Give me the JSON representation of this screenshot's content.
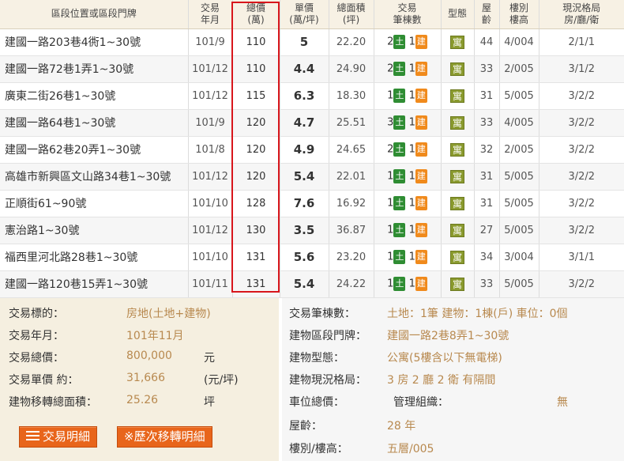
{
  "table": {
    "headers": {
      "address": "區段位置或區段門牌",
      "date_1": "交易",
      "date_2": "年月",
      "total_1": "總價",
      "total_2": "(萬)",
      "unit_1": "單價",
      "unit_2": "(萬/坪)",
      "area_1": "總面積",
      "area_2": "(坪)",
      "count_1": "交易",
      "count_2": "筆棟數",
      "type": "型態",
      "age_1": "屋",
      "age_2": "齡",
      "floor_1": "樓別",
      "floor_2": "樓高",
      "layout_1": "現況格局",
      "layout_2": "房/廳/衛"
    },
    "badge_land": "土",
    "badge_building": "建",
    "rows": [
      {
        "address": "建國一路203巷4衖1~30號",
        "date": "101/9",
        "total": "110",
        "unit": "5",
        "area": "22.20",
        "land": "2",
        "bldg": "1",
        "type": "寓",
        "age": "44",
        "floor": "4/004",
        "layout": "2/1/1"
      },
      {
        "address": "建國一路72巷1弄1~30號",
        "date": "101/12",
        "total": "110",
        "unit": "4.4",
        "area": "24.90",
        "land": "2",
        "bldg": "1",
        "type": "寓",
        "age": "33",
        "floor": "2/005",
        "layout": "3/1/2"
      },
      {
        "address": "廣東二街26巷1~30號",
        "date": "101/12",
        "total": "115",
        "unit": "6.3",
        "area": "18.30",
        "land": "1",
        "bldg": "1",
        "type": "寓",
        "age": "31",
        "floor": "5/005",
        "layout": "3/2/2"
      },
      {
        "address": "建國一路64巷1~30號",
        "date": "101/9",
        "total": "120",
        "unit": "4.7",
        "area": "25.51",
        "land": "3",
        "bldg": "1",
        "type": "寓",
        "age": "33",
        "floor": "4/005",
        "layout": "3/2/2"
      },
      {
        "address": "建國一路62巷20弄1~30號",
        "date": "101/8",
        "total": "120",
        "unit": "4.9",
        "area": "24.65",
        "land": "2",
        "bldg": "1",
        "type": "寓",
        "age": "32",
        "floor": "2/005",
        "layout": "3/2/2"
      },
      {
        "address": "高雄市新興區文山路34巷1~30號",
        "date": "101/12",
        "total": "120",
        "unit": "5.4",
        "area": "22.01",
        "land": "1",
        "bldg": "1",
        "type": "寓",
        "age": "31",
        "floor": "5/005",
        "layout": "3/2/2"
      },
      {
        "address": "正順街61~90號",
        "date": "101/10",
        "total": "128",
        "unit": "7.6",
        "area": "16.92",
        "land": "1",
        "bldg": "1",
        "type": "寓",
        "age": "31",
        "floor": "5/005",
        "layout": "3/2/2"
      },
      {
        "address": "憲治路1~30號",
        "date": "101/12",
        "total": "130",
        "unit": "3.5",
        "area": "36.87",
        "land": "1",
        "bldg": "1",
        "type": "寓",
        "age": "27",
        "floor": "5/005",
        "layout": "3/2/2"
      },
      {
        "address": "福西里河北路28巷1~30號",
        "date": "101/10",
        "total": "131",
        "unit": "5.6",
        "area": "23.20",
        "land": "1",
        "bldg": "1",
        "type": "寓",
        "age": "34",
        "floor": "3/004",
        "layout": "3/1/1"
      },
      {
        "address": "建國一路120巷15弄1~30號",
        "date": "101/11",
        "total": "131",
        "unit": "5.4",
        "area": "24.22",
        "land": "1",
        "bldg": "1",
        "type": "寓",
        "age": "33",
        "floor": "5/005",
        "layout": "3/2/2"
      }
    ]
  },
  "details": {
    "left": {
      "target_label": "交易標的：",
      "target_value": "房地(土地+建物)",
      "date_label": "交易年月：",
      "date_value": "101年11月",
      "total_label": "交易總價：",
      "total_value": "800,000",
      "total_unit": "元",
      "unit_label": "交易單價 約：",
      "unit_value": "31,666",
      "unit_unit": "(元/坪)",
      "area_label": "建物移轉總面積：",
      "area_value": "25.26",
      "area_unit": "坪"
    },
    "right": {
      "count_label": "交易筆棟數：",
      "count_value": "土地：1筆 建物：1棟(戶) 車位：0個",
      "addr_label": "建物區段門牌：",
      "addr_value": "建國一路2巷8弄1~30號",
      "btype_label": "建物型態：",
      "btype_value": "公寓(5樓含以下無電梯)",
      "layout_label": "建物現況格局：",
      "layout_value": "3 房 2 廳 2 衛 有隔間",
      "parking_label": "車位總價：",
      "mgmt_label": "管理組織：",
      "mgmt_value": "無",
      "age_label": "屋齡：",
      "age_value": "28 年",
      "floor_label": "樓別/樓高：",
      "floor_value": "五層/005"
    },
    "buttons": {
      "detail": "交易明細",
      "history": "※歷次移轉明細"
    }
  },
  "colors": {
    "highlight": "#d8161c",
    "land_badge": "#2f8d33",
    "building_badge": "#f08a1c",
    "type_badge": "#8a9a2e",
    "button": "#e8651b",
    "value_text": "#b8894f"
  }
}
